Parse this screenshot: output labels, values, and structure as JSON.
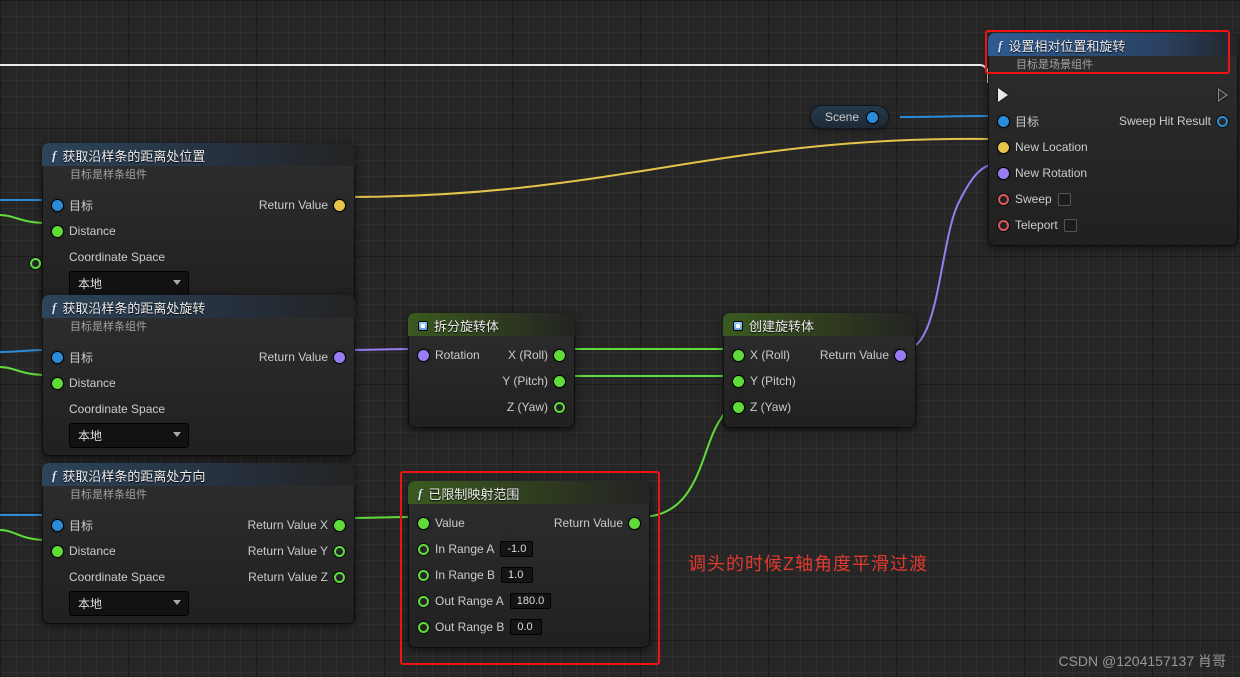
{
  "nodes": {
    "loc": {
      "title": "获取沿样条的距离处位置",
      "subtitle": "目标是样条组件",
      "target": "目标",
      "distance": "Distance",
      "coord": "Coordinate Space",
      "coord_value": "本地",
      "return": "Return Value"
    },
    "rot": {
      "title": "获取沿样条的距离处旋转",
      "subtitle": "目标是样条组件",
      "target": "目标",
      "distance": "Distance",
      "coord": "Coordinate Space",
      "coord_value": "本地",
      "return": "Return Value"
    },
    "dir": {
      "title": "获取沿样条的距离处方向",
      "subtitle": "目标是样条组件",
      "target": "目标",
      "distance": "Distance",
      "coord": "Coordinate Space",
      "coord_value": "本地",
      "rx": "Return Value X",
      "ry": "Return Value Y",
      "rz": "Return Value Z"
    },
    "break": {
      "title": "拆分旋转体",
      "in": "Rotation",
      "roll": "X (Roll)",
      "pitch": "Y (Pitch)",
      "yaw": "Z (Yaw)"
    },
    "make": {
      "title": "创建旋转体",
      "roll": "X (Roll)",
      "pitch": "Y (Pitch)",
      "yaw": "Z (Yaw)",
      "return": "Return Value"
    },
    "map": {
      "title": "已限制映射范围",
      "value": "Value",
      "inA": "In Range A",
      "inB": "In Range B",
      "outA": "Out Range A",
      "outB": "Out Range B",
      "return": "Return Value",
      "v_inA": "-1.0",
      "v_inB": "1.0",
      "v_outA": "180.0",
      "v_outB": "0.0"
    },
    "set": {
      "title": "设置相对位置和旋转",
      "subtitle": "目标是场景组件",
      "target": "目标",
      "newloc": "New Location",
      "newrot": "New Rotation",
      "sweep": "Sweep",
      "teleport": "Teleport",
      "sweephit": "Sweep Hit Result"
    },
    "scene": {
      "label": "Scene"
    }
  },
  "annotation": "调头的时候Z轴角度平滑过渡",
  "watermark": "CSDN @1204157137 肖哥"
}
